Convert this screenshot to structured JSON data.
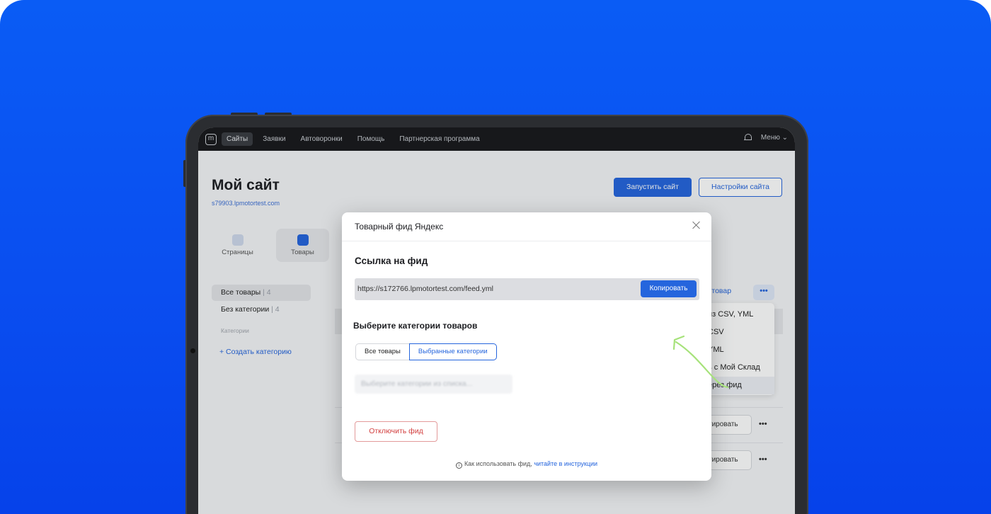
{
  "topnav": {
    "logo_letter": "m",
    "items": [
      "Сайты",
      "Заявки",
      "Автоворонки",
      "Помощь",
      "Партнерская программа"
    ],
    "menu_label": "Меню ⌄"
  },
  "page": {
    "title": "Мой сайт",
    "subdomain": "s79903.lpmotortest.com",
    "launch_button": "Запустить сайт",
    "settings_button": "Настройки сайта",
    "tabs": [
      "Страницы",
      "Товары"
    ]
  },
  "sidebar": {
    "all_goods": "Все товары",
    "all_goods_count": "| 4",
    "no_category": "Без категории",
    "no_category_count": "| 4",
    "categories_label": "Категории",
    "create_category": "+ Создать категорию"
  },
  "right_panel": {
    "add_link": "ь товар",
    "dots": "•••",
    "row_button": "тировать",
    "row_dots": "•••"
  },
  "dropdown": {
    "items": [
      "из CSV, YML",
      "CSV",
      "YML",
      "ь с Мой Склад",
      "ерез фид"
    ]
  },
  "modal": {
    "title": "Товарный фид Яндекс",
    "feed_section_title": "Ссылка на фид",
    "feed_url": "https://s172766.lpmotortest.com/feed.yml",
    "copy_button": "Копировать",
    "categories_title": "Выберите категории товаров",
    "segment_all": "Все товары",
    "segment_selected": "Выбранные категории",
    "category_placeholder": "Выберите категории из списка...",
    "disable_button": "Отключить фид",
    "help_text": "Как использовать фид,",
    "help_link": "читайте в инструкции"
  },
  "colors": {
    "background": "#0a55f2",
    "primary": "#2565dd",
    "danger": "#d23e3e",
    "arrow": "#a6e27a"
  }
}
